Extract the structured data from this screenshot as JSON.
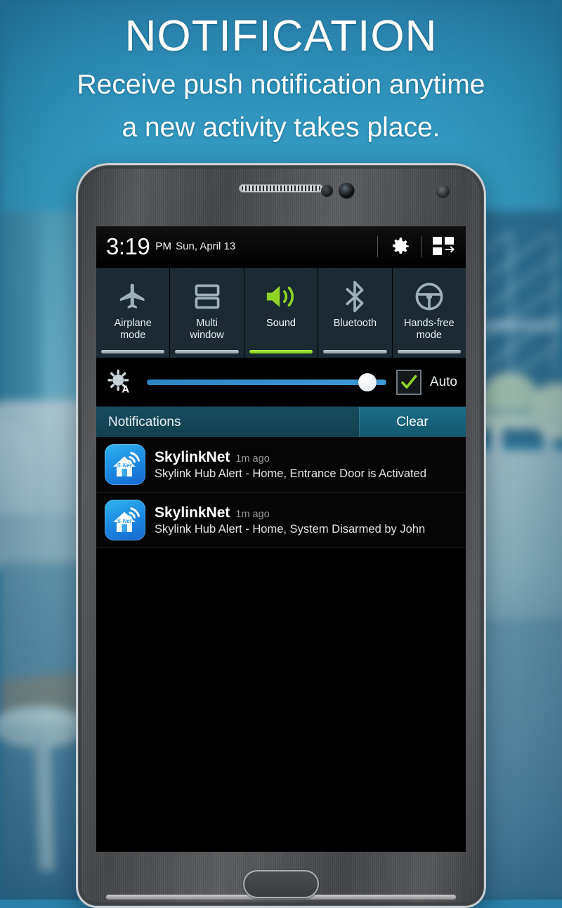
{
  "headline": {
    "title": "NOTIFICATION",
    "subtitle_line1": "Receive push notification anytime",
    "subtitle_line2": "a new activity takes place."
  },
  "colors": {
    "accent_blue": "#2b7fa8",
    "active_green": "#8fd426",
    "panel_header": "#174c5e",
    "clear_button": "#1b6c88",
    "slider_blue": "#3d9ad8",
    "toggle_tile": "#1b2a33"
  },
  "phone": {
    "statusbar": {
      "time": "3:19",
      "ampm": "PM",
      "date": "Sun, April 13",
      "settings_icon": "gear-icon",
      "quick_settings_icon": "quick-settings-grid-icon"
    },
    "toggles": [
      {
        "label_line1": "Airplane",
        "label_line2": "mode",
        "icon": "airplane-icon",
        "active": false
      },
      {
        "label_line1": "Multi",
        "label_line2": "window",
        "icon": "multiwindow-icon",
        "active": false
      },
      {
        "label_line1": "Sound",
        "label_line2": "",
        "icon": "speaker-icon",
        "active": true
      },
      {
        "label_line1": "Bluetooth",
        "label_line2": "",
        "icon": "bluetooth-icon",
        "active": false
      },
      {
        "label_line1": "Hands-free",
        "label_line2": "mode",
        "icon": "steering-wheel-icon",
        "active": false
      }
    ],
    "brightness": {
      "icon": "brightness-auto-icon",
      "value_percent": 96,
      "auto_label": "Auto",
      "auto_checked": true,
      "check_icon": "checkmark-icon"
    },
    "notifications_panel": {
      "header_title": "Notifications",
      "clear_label": "Clear",
      "items": [
        {
          "app": "SkylinkNet",
          "time": "1m ago",
          "text": "Skylink Hub Alert - Home, Entrance Door is Activated",
          "icon": "skylinknet-home-icon",
          "icon_badge_text": "S-Net"
        },
        {
          "app": "SkylinkNet",
          "time": "1m ago",
          "text": "Skylink Hub Alert - Home, System Disarmed by John",
          "icon": "skylinknet-home-icon",
          "icon_badge_text": "S-Net"
        }
      ]
    },
    "hardware": {
      "earpiece": "speaker-grille",
      "front_camera": "camera-icon",
      "proximity_sensor": "sensor-icon",
      "home_button": "home-button"
    }
  }
}
